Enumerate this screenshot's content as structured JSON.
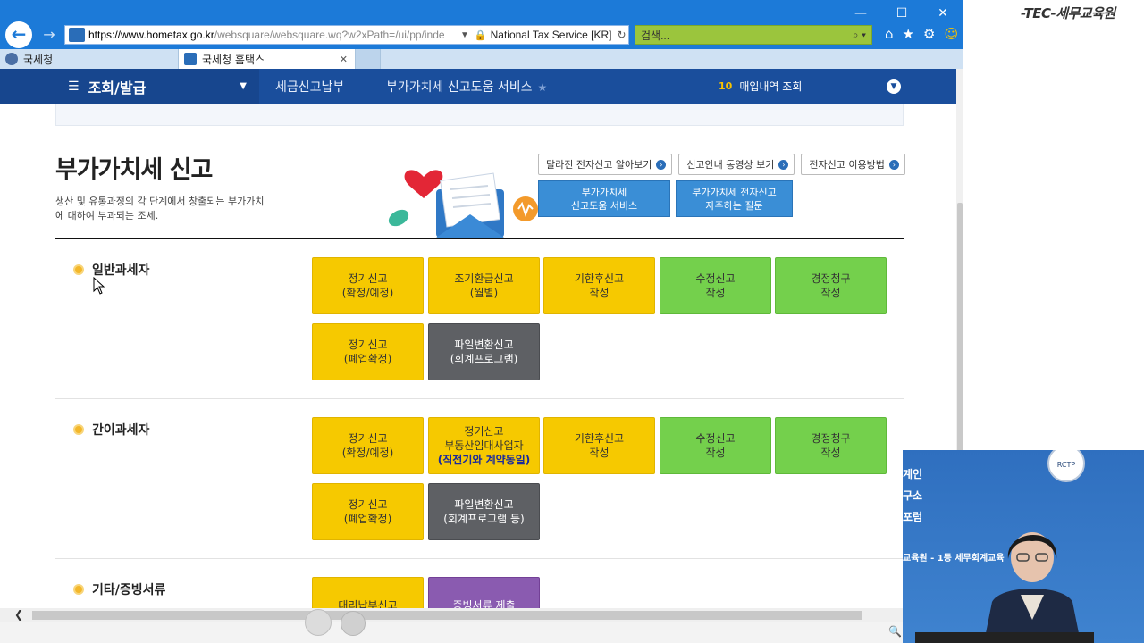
{
  "browser": {
    "window_controls": [
      "—",
      "☐",
      "✕"
    ],
    "url_host": "https://www.hometax.go.kr",
    "url_rest": "/websquare/websquare.wq?w2xPath=/ui/pp/inde",
    "site_identity": "National Tax Service [KR]",
    "search_placeholder": "검색...",
    "tabs": [
      {
        "label": "국세청",
        "active": false
      },
      {
        "label": "국세청 홈택스",
        "active": true
      }
    ]
  },
  "nav": {
    "menu_label": "조회/발급",
    "crumb1": "세금신고납부",
    "crumb2": "부가가치세 신고도움 서비스",
    "quick_icon": "10",
    "quick_label": "매입내역 조회"
  },
  "page": {
    "title": "부가가치세 신고",
    "desc": "생산 및 유통과정의 각 단계에서 창출되는 부가가치에 대하여 부과되는 조세.",
    "help_buttons": [
      {
        "label": "달라진 전자신고 알아보기"
      },
      {
        "label": "신고안내 동영상 보기"
      },
      {
        "label": "전자신고 이용방법"
      }
    ],
    "big_buttons": [
      {
        "line1": "부가가치세",
        "line2": "신고도움 서비스"
      },
      {
        "line1": "부가가치세 전자신고",
        "line2": "자주하는 질문"
      }
    ],
    "sections": [
      {
        "label": "일반과세자",
        "buttons": [
          {
            "l1": "정기신고",
            "l2": "(확정/예정)",
            "color": "yellow"
          },
          {
            "l1": "조기환급신고",
            "l2": "(월별)",
            "color": "yellow"
          },
          {
            "l1": "기한후신고",
            "l2": "작성",
            "color": "yellow"
          },
          {
            "l1": "수정신고",
            "l2": "작성",
            "color": "green"
          },
          {
            "l1": "경정청구",
            "l2": "작성",
            "color": "green"
          },
          {
            "l1": "정기신고",
            "l2": "(폐업확정)",
            "color": "yellow"
          },
          {
            "l1": "파일변환신고",
            "l2": "(회계프로그램)",
            "color": "gray"
          }
        ]
      },
      {
        "label": "간이과세자",
        "buttons": [
          {
            "l1": "정기신고",
            "l2": "(확정/예정)",
            "color": "yellow"
          },
          {
            "l1": "정기신고",
            "l2": "부동산임대사업자",
            "l3": "(직전기와 계약동일)",
            "color": "yellow"
          },
          {
            "l1": "기한후신고",
            "l2": "작성",
            "color": "yellow"
          },
          {
            "l1": "수정신고",
            "l2": "작성",
            "color": "green"
          },
          {
            "l1": "경정청구",
            "l2": "작성",
            "color": "green"
          },
          {
            "l1": "정기신고",
            "l2": "(폐업확정)",
            "color": "yellow"
          },
          {
            "l1": "파일변환신고",
            "l2": "(회계프로그램 등)",
            "color": "gray"
          }
        ]
      },
      {
        "label": "기타/증빙서류",
        "buttons": [
          {
            "l1": "대리납부신고",
            "color": "yellow"
          },
          {
            "l1": "증빙서류 제출",
            "color": "purple"
          }
        ]
      }
    ]
  },
  "overlay": {
    "logo": "-TEC-세무교육원",
    "video_lines": [
      "계인",
      "구소",
      "포럼"
    ],
    "video_caption": "교육원 - 1등 세무회계교육",
    "rctp": "RCTP"
  }
}
